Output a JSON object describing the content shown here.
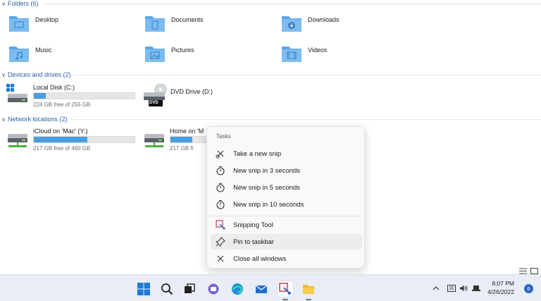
{
  "sections": {
    "folders": "Folders (6)",
    "devices": "Devices and drives (2)",
    "network": "Network locations (2)"
  },
  "folders": [
    {
      "label": "Desktop",
      "icon": "desktop-folder-icon"
    },
    {
      "label": "Documents",
      "icon": "documents-folder-icon"
    },
    {
      "label": "Downloads",
      "icon": "downloads-folder-icon"
    },
    {
      "label": "Music",
      "icon": "music-folder-icon"
    },
    {
      "label": "Pictures",
      "icon": "pictures-folder-icon"
    },
    {
      "label": "Videos",
      "icon": "videos-folder-icon"
    }
  ],
  "drives": [
    {
      "name": "Local Disk (C:)",
      "free": "224 GB free of 255 GB",
      "used_fraction": 0.12
    },
    {
      "name": "DVD Drive (D:)",
      "badge": "DVD"
    }
  ],
  "network": [
    {
      "name": "iCloud on 'Mac' (Y:)",
      "free": "217 GB free of 460 GB",
      "used_fraction": 0.53
    },
    {
      "name": "Home on 'M",
      "free": "217 GB fr",
      "used_fraction": 0.53
    }
  ],
  "menu": {
    "title": "Tasks",
    "items": [
      {
        "label": "Take a new snip",
        "icon": "snip-icon"
      },
      {
        "label": "New snip in 3 seconds",
        "icon": "timer-3-icon"
      },
      {
        "label": "New snip in 5 seconds",
        "icon": "timer-5-icon"
      },
      {
        "label": "New snip in 10 seconds",
        "icon": "timer-10-icon"
      },
      {
        "label": "Snipping Tool",
        "icon": "snipping-tool-icon"
      },
      {
        "label": "Pin to taskbar",
        "icon": "pin-icon"
      },
      {
        "label": "Close all windows",
        "icon": "close-icon"
      }
    ]
  },
  "taskbar": {
    "time": "8:07 PM",
    "date": "4/26/2022",
    "notification_count": "6"
  },
  "colors": {
    "accent": "#2b66c4",
    "folder": "#5aa6e6",
    "drive_fill": "#4a9ee0"
  }
}
